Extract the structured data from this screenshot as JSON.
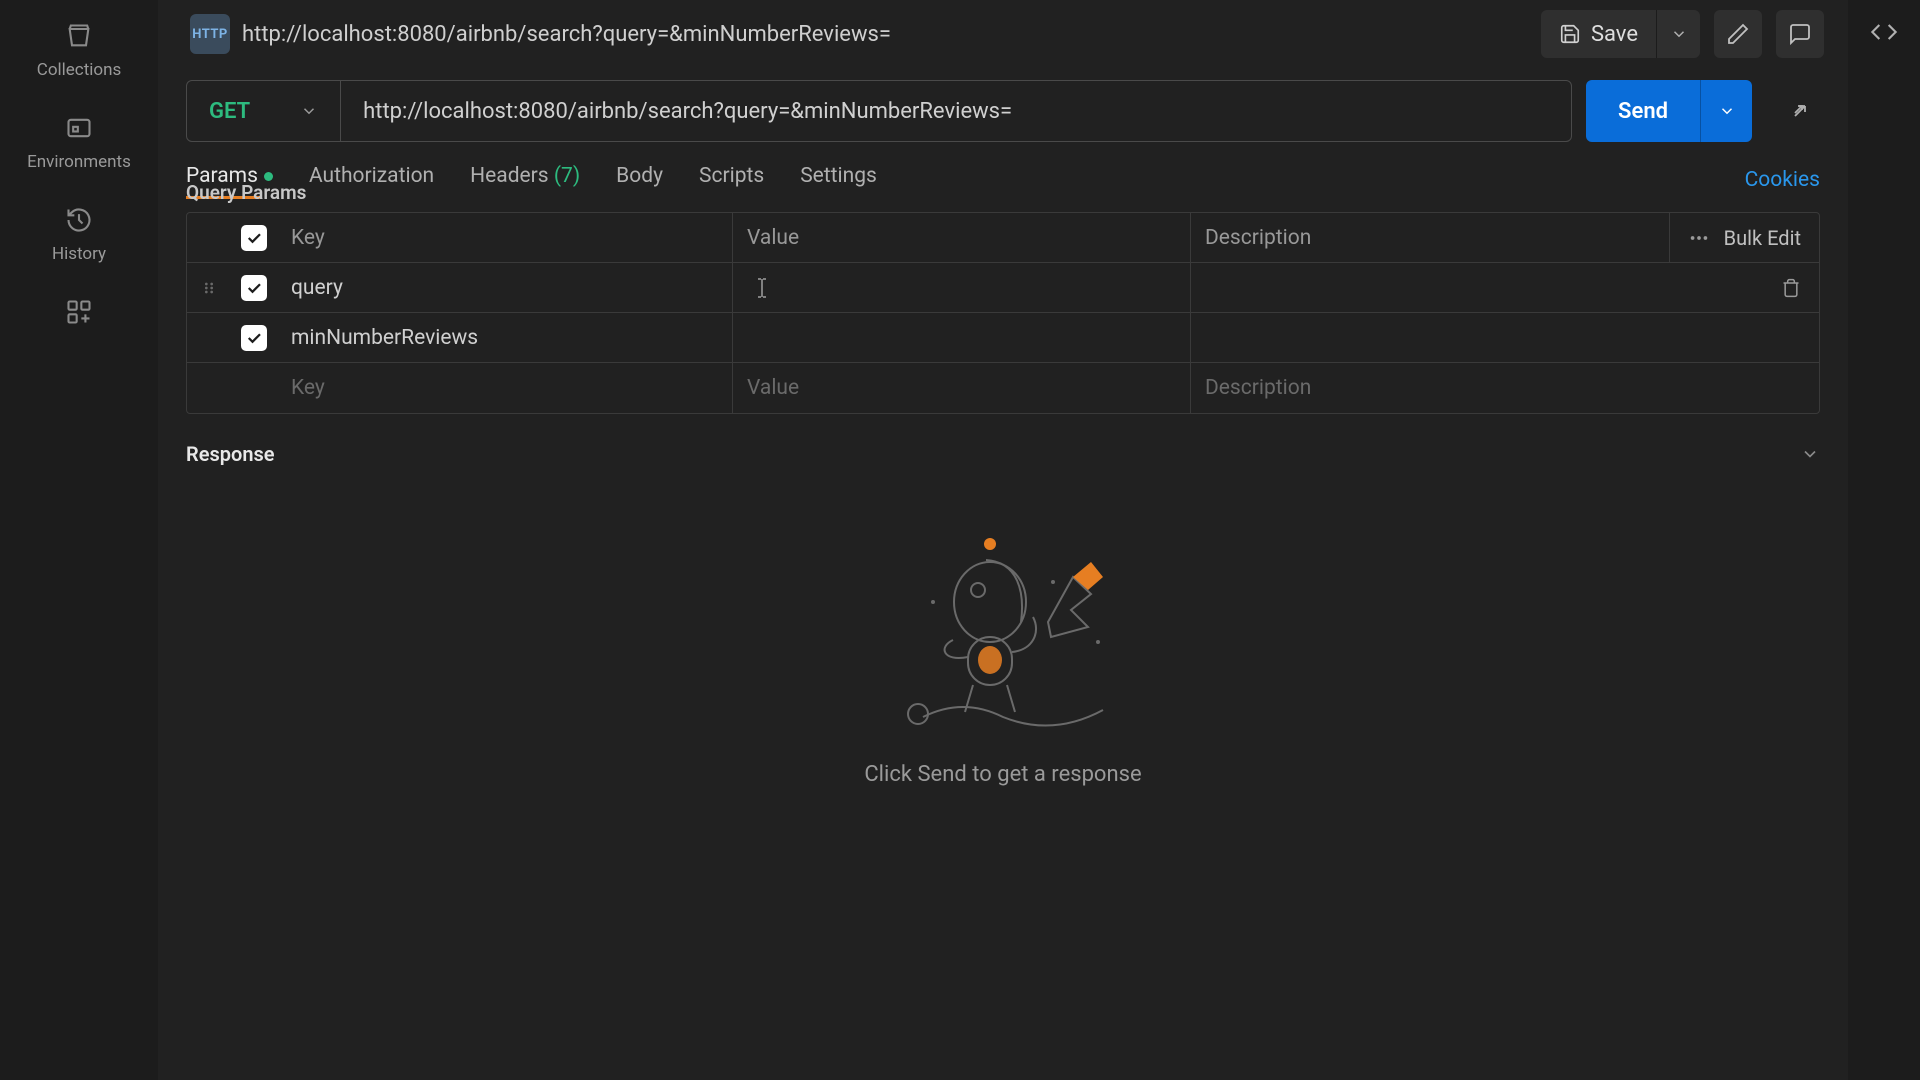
{
  "sidebar": {
    "items": [
      {
        "label": "Collections"
      },
      {
        "label": "Environments"
      },
      {
        "label": "History"
      }
    ]
  },
  "topbar": {
    "http_label": "HTTP",
    "url": "http://localhost:8080/airbnb/search?query=&minNumberReviews=",
    "save_label": "Save"
  },
  "request": {
    "method": "GET",
    "url": "http://localhost:8080/airbnb/search?query=&minNumberReviews=",
    "send_label": "Send"
  },
  "tabs": {
    "params": "Params",
    "authorization": "Authorization",
    "headers": "Headers",
    "headers_count": "(7)",
    "body": "Body",
    "scripts": "Scripts",
    "settings": "Settings",
    "cookies": "Cookies"
  },
  "query_params": {
    "title": "Query Params",
    "headers": {
      "key": "Key",
      "value": "Value",
      "description": "Description"
    },
    "bulk_edit": "Bulk Edit",
    "rows": [
      {
        "key": "query",
        "value": "",
        "description": ""
      },
      {
        "key": "minNumberReviews",
        "value": "",
        "description": ""
      }
    ],
    "placeholder": {
      "key": "Key",
      "value": "Value",
      "description": "Description"
    }
  },
  "response": {
    "title": "Response",
    "hint": "Click Send to get a response"
  },
  "colors": {
    "accent_blue": "#0a6dd9",
    "accent_green": "#2dbb7f",
    "accent_orange": "#e67e22",
    "link_blue": "#2a97ec"
  }
}
